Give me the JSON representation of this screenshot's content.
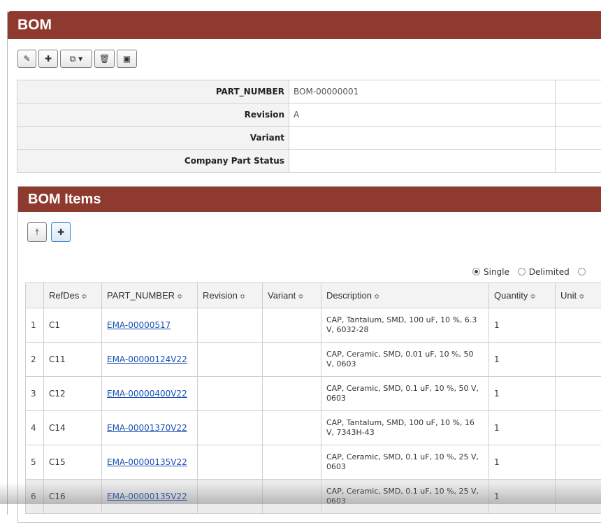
{
  "panel": {
    "title": "BOM"
  },
  "toolbar": [
    {
      "name": "edit-button",
      "icon": "pencil-icon",
      "glyph": "✎"
    },
    {
      "name": "add-button",
      "icon": "plus-icon",
      "glyph": "✚"
    },
    {
      "name": "copy-dropdown-button",
      "icon": "copy-icon",
      "glyph": "⧉ ▾"
    },
    {
      "name": "delete-button",
      "icon": "trash-icon",
      "glyph": "🗑"
    },
    {
      "name": "save-button",
      "icon": "save-icon",
      "glyph": "▣"
    }
  ],
  "form": {
    "fields": [
      {
        "label": "PART_NUMBER",
        "value": "BOM-00000001"
      },
      {
        "label": "Revision",
        "value": "A"
      },
      {
        "label": "Variant",
        "value": ""
      },
      {
        "label": "Company Part Status",
        "value": ""
      }
    ]
  },
  "bom_items": {
    "title": "BOM Items",
    "toolbar": [
      {
        "name": "collapse-button",
        "icon": "collapse-top-icon",
        "glyph": "⤒"
      },
      {
        "name": "add-item-button",
        "icon": "plus-icon",
        "glyph": "✚"
      }
    ],
    "view_modes": [
      {
        "label": "Single",
        "selected": true
      },
      {
        "label": "Delimited",
        "selected": false
      },
      {
        "label": "",
        "selected": false
      }
    ],
    "columns": [
      "",
      "RefDes",
      "PART_NUMBER",
      "Revision",
      "Variant",
      "Description",
      "Quantity",
      "Unit"
    ],
    "sort_glyph": "≎",
    "rows": [
      {
        "num": "1",
        "refdes": "C1",
        "part_number": "EMA-00000517",
        "revision": "",
        "variant": "",
        "description": "CAP, Tantalum, SMD, 100 uF, 10 %, 6.3 V, 6032-28",
        "quantity": "1",
        "unit": ""
      },
      {
        "num": "2",
        "refdes": "C11",
        "part_number": "EMA-00000124V22",
        "revision": "",
        "variant": "",
        "description": "CAP, Ceramic, SMD, 0.01 uF, 10 %, 50 V, 0603",
        "quantity": "1",
        "unit": ""
      },
      {
        "num": "3",
        "refdes": "C12",
        "part_number": "EMA-00000400V22",
        "revision": "",
        "variant": "",
        "description": "CAP, Ceramic, SMD, 0.1 uF, 10 %, 50 V, 0603",
        "quantity": "1",
        "unit": ""
      },
      {
        "num": "4",
        "refdes": "C14",
        "part_number": "EMA-00001370V22",
        "revision": "",
        "variant": "",
        "description": "CAP, Tantalum, SMD, 100 uF, 10 %, 16 V, 7343H-43",
        "quantity": "1",
        "unit": ""
      },
      {
        "num": "5",
        "refdes": "C15",
        "part_number": "EMA-00000135V22",
        "revision": "",
        "variant": "",
        "description": "CAP, Ceramic, SMD, 0.1 uF, 10 %, 25 V, 0603",
        "quantity": "1",
        "unit": ""
      },
      {
        "num": "6",
        "refdes": "C16",
        "part_number": "EMA-00000135V22",
        "revision": "",
        "variant": "",
        "description": "CAP, Ceramic, SMD, 0.1 uF, 10 %, 25 V, 0603",
        "quantity": "1",
        "unit": ""
      }
    ]
  },
  "colors": {
    "header": "#8e3a2f",
    "link": "#1a4fb3"
  }
}
